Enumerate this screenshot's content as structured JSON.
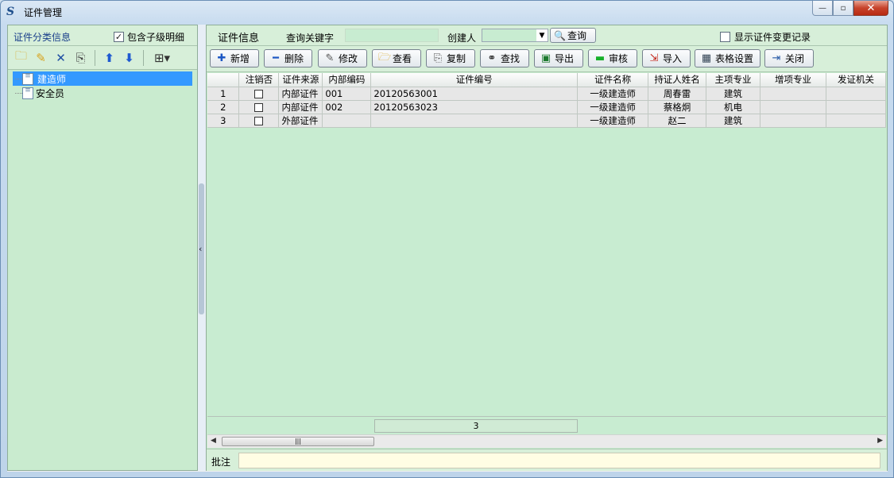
{
  "window": {
    "title": "证件管理",
    "controls": [
      "minimize",
      "maximize",
      "close"
    ]
  },
  "left": {
    "title": "证件分类信息",
    "include_children_label": "包含子级明细",
    "include_children_checked": true,
    "toolbar_icons": [
      "add-folder-icon",
      "edit-folder-icon",
      "delete-icon",
      "refresh-icon",
      "arrow-up-icon",
      "arrow-down-icon",
      "tree-view-icon"
    ],
    "tree": [
      {
        "label": "建造师",
        "selected": true
      },
      {
        "label": "安全员",
        "selected": false
      }
    ]
  },
  "query": {
    "title": "证件信息",
    "keyword_label": "查询关键字",
    "keyword_value": "",
    "creator_label": "创建人",
    "creator_value": "",
    "search_label": "查询",
    "show_changes_label": "显示证件变更记录",
    "show_changes_checked": false
  },
  "toolbar": {
    "add": "新增",
    "delete": "删除",
    "edit": "修改",
    "view": "查看",
    "copy": "复制",
    "find": "查找",
    "export": "导出",
    "approve": "审核",
    "import": "导入",
    "grid_settings": "表格设置",
    "close": "关闭"
  },
  "table": {
    "columns": [
      "",
      "注销否",
      "证件来源",
      "内部编码",
      "证件编号",
      "证件名称",
      "持证人姓名",
      "主项专业",
      "增项专业",
      "发证机关"
    ],
    "rows": [
      {
        "no": "1",
        "cancelled": false,
        "source": "内部证件",
        "code": "001",
        "cert_no": "20120563001",
        "cert_name": "一级建造师",
        "holder": "周春雷",
        "major": "建筑",
        "extra_major": "",
        "authority": ""
      },
      {
        "no": "2",
        "cancelled": false,
        "source": "内部证件",
        "code": "002",
        "cert_no": "20120563023",
        "cert_name": "一级建造师",
        "holder": "蔡格炯",
        "major": "机电",
        "extra_major": "",
        "authority": ""
      },
      {
        "no": "3",
        "cancelled": false,
        "source": "外部证件",
        "code": "",
        "cert_no": "",
        "cert_name": "一级建造师",
        "holder": "赵二",
        "major": "建筑",
        "extra_major": "",
        "authority": ""
      }
    ],
    "footer_count": "3"
  },
  "remark": {
    "label": "批注",
    "value": ""
  }
}
